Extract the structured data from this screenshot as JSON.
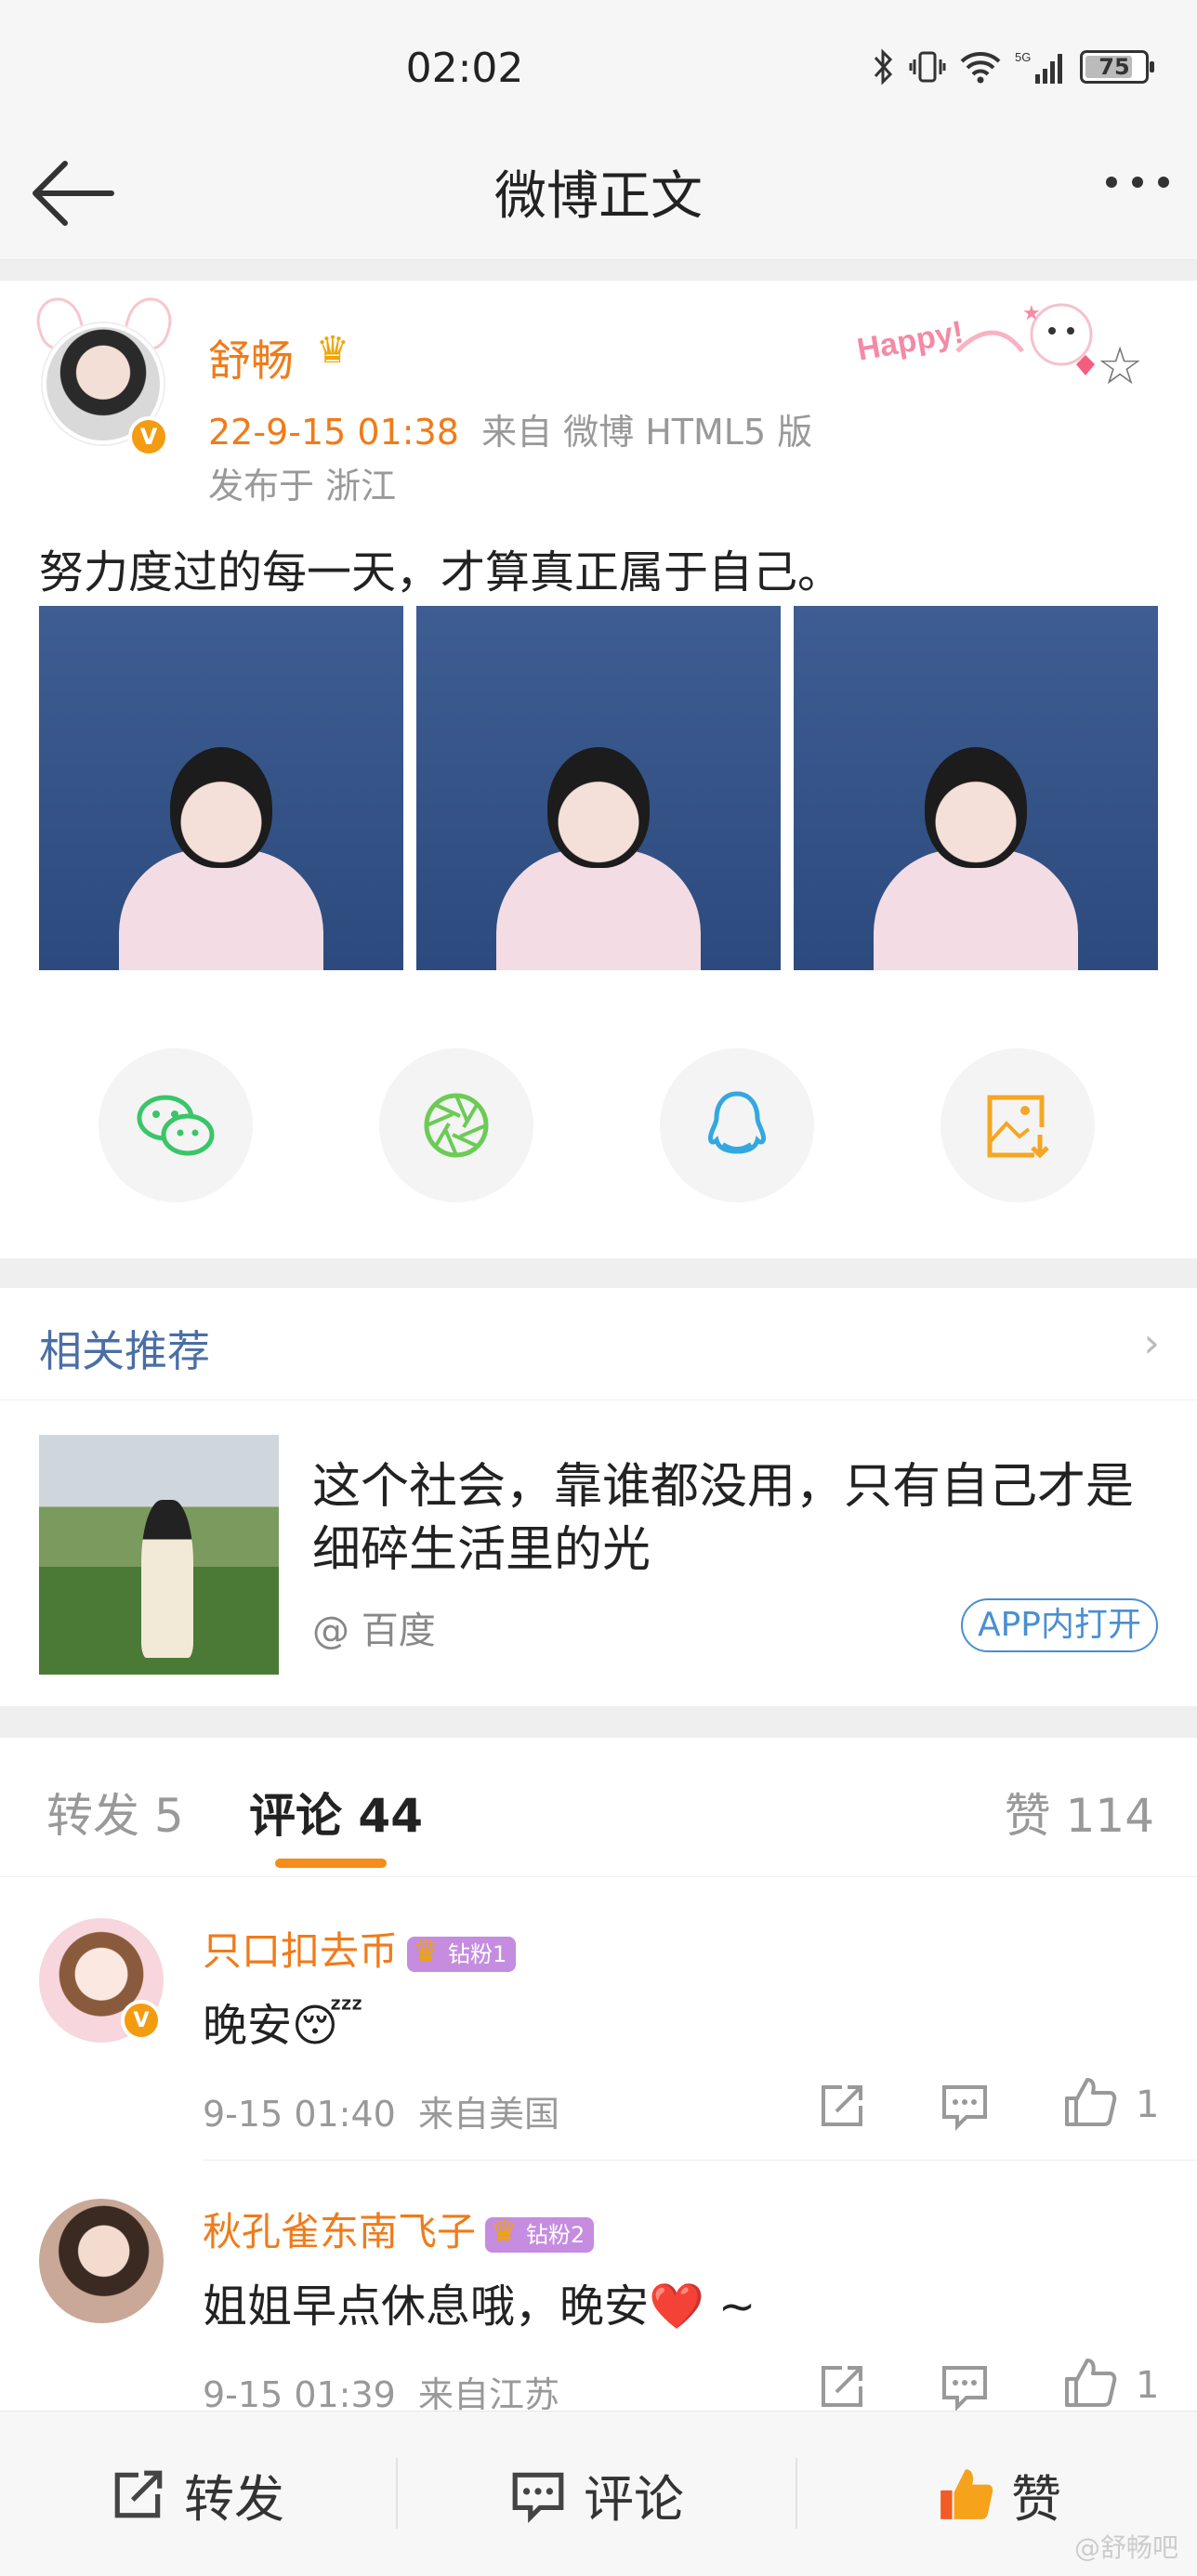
{
  "status_bar": {
    "time": "02:02",
    "battery": "75"
  },
  "nav": {
    "title": "微博正文"
  },
  "post": {
    "author": "舒畅",
    "time": "22-9-15 01:38",
    "source": "来自 微博 HTML5 版",
    "location": "发布于 浙江",
    "content": "努力度过的每一天，才算真正属于自己。",
    "photo_count": 3,
    "happy_sticker_text": "Happy!"
  },
  "share": {
    "icons": [
      "wechat-icon",
      "moments-icon",
      "qq-icon",
      "save-image-icon"
    ]
  },
  "related": {
    "title": "相关推荐",
    "text": "这个社会，靠谁都没用，只有自己才是细碎生活里的光",
    "source": "@ 百度",
    "open_label": "APP内打开"
  },
  "tabs": {
    "repost": "转发 5",
    "comment": "评论 44",
    "like": "赞 114"
  },
  "comments": [
    {
      "name": "只口扣去币",
      "badge": "钻粉1",
      "text": "晚安😴",
      "time": "9-15 01:40",
      "from": "来自美国",
      "likes": "1"
    },
    {
      "name": "秋孔雀东南飞子",
      "badge": "钻粉2",
      "text": "姐姐早点休息哦，晚安❤️ ~",
      "time": "9-15 01:39",
      "from": "来自江苏",
      "likes": "1"
    }
  ],
  "bottom_bar": {
    "repost": "转发",
    "comment": "评论",
    "like": "赞"
  },
  "watermark": "@舒畅吧",
  "colors": {
    "accent": "#f07b1a",
    "link": "#4a6fa5",
    "like": "#f0a500"
  }
}
